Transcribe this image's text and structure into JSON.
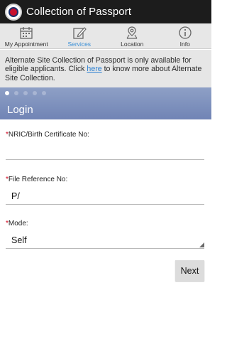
{
  "header": {
    "title": "Collection of Passport"
  },
  "tabs": [
    {
      "label": "My Appointment",
      "icon": "calendar-icon"
    },
    {
      "label": "Services",
      "icon": "edit-icon"
    },
    {
      "label": "Location",
      "icon": "location-pin-icon"
    },
    {
      "label": "Info",
      "icon": "info-icon"
    }
  ],
  "active_tab": "Services",
  "notice": {
    "text_before": "Alternate Site Collection of Passport is only available for eligible applicants. Click ",
    "link": "here",
    "text_after": " to know more about Alternate Site Collection."
  },
  "carousel": {
    "count": 5,
    "active_index": 0
  },
  "form": {
    "heading": "Login",
    "required_mark": "*",
    "nric": {
      "label": "NRIC/Birth Certificate No:",
      "value": ""
    },
    "file_ref": {
      "label": "File Reference No:",
      "value": "P/"
    },
    "mode": {
      "label": "Mode:",
      "value": "Self"
    },
    "next_label": "Next"
  },
  "colors": {
    "titlebar": "#1c1c1c",
    "active_tab": "#3a8fd6",
    "banner": "#7f92bd",
    "required": "#d0021b",
    "link": "#2a7fd1"
  }
}
